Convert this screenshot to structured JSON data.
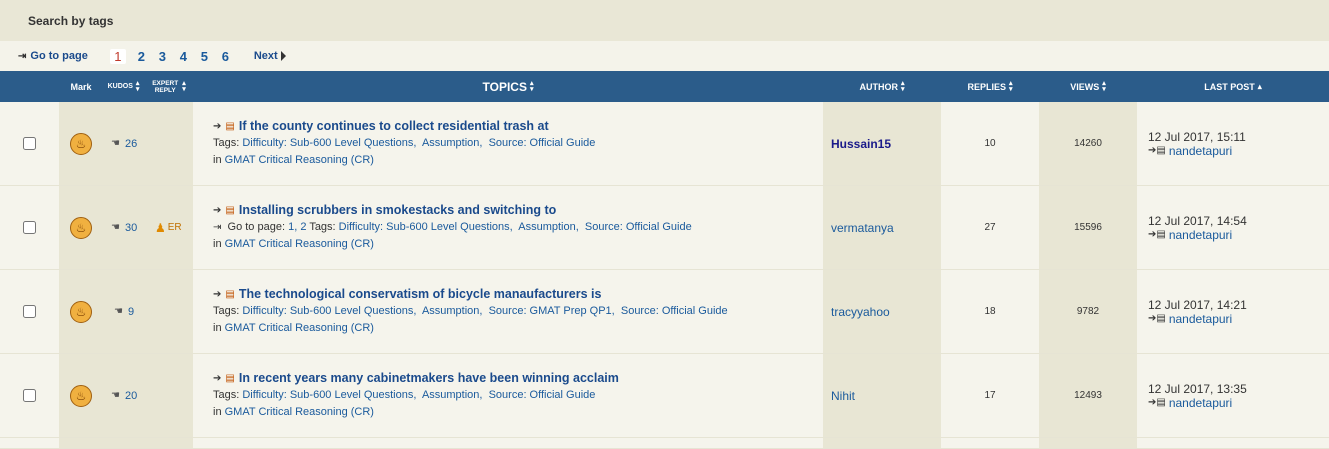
{
  "search": {
    "label": "Search by tags"
  },
  "pager": {
    "goto_label": "Go to page",
    "pages": [
      "1",
      "2",
      "3",
      "4",
      "5",
      "6"
    ],
    "current": "1",
    "next_label": "Next"
  },
  "header": {
    "mark": "Mark",
    "kudos": "KUDOS",
    "expert_reply": "EXPERT REPLY",
    "topics": "TOPICS",
    "author": "AUTHOR",
    "replies": "REPLIES",
    "views": "VIEWS",
    "last_post": "LAST POST"
  },
  "topics": [
    {
      "title": "If the county continues to collect residential trash at",
      "kudos": "26",
      "expert": "",
      "goto_pages": "",
      "tags_label": "Tags:",
      "tags": [
        "Difficulty: Sub-600 Level Questions,",
        "Assumption,",
        "Source: Official Guide"
      ],
      "forum_prefix": "in",
      "forum": "GMAT Critical Reasoning (CR)",
      "author": "Hussain15",
      "author_bold": true,
      "replies": "10",
      "views": "14260",
      "last_date": "12 Jul 2017, 15:11",
      "last_user": "nandetapuri"
    },
    {
      "title": "Installing scrubbers in smokestacks and switching to",
      "kudos": "30",
      "expert": "ER",
      "goto_pages": "Go to page:",
      "goto_links": [
        "1,",
        "2"
      ],
      "tags_label": "Tags:",
      "tags": [
        "Difficulty: Sub-600 Level Questions,",
        "Assumption,",
        "Source: Official Guide"
      ],
      "forum_prefix": "in",
      "forum": "GMAT Critical Reasoning (CR)",
      "author": "vermatanya",
      "author_bold": false,
      "replies": "27",
      "views": "15596",
      "last_date": "12 Jul 2017, 14:54",
      "last_user": "nandetapuri"
    },
    {
      "title": "The technological conservatism of bicycle manaufacturers is",
      "kudos": "9",
      "expert": "",
      "goto_pages": "",
      "tags_label": "Tags:",
      "tags": [
        "Difficulty: Sub-600 Level Questions,",
        "Assumption,",
        "Source: GMAT Prep QP1,",
        "Source: Official Guide"
      ],
      "forum_prefix": "in",
      "forum": "GMAT Critical Reasoning (CR)",
      "author": "tracyyahoo",
      "author_bold": false,
      "replies": "18",
      "views": "9782",
      "last_date": "12 Jul 2017, 14:21",
      "last_user": "nandetapuri"
    },
    {
      "title": "In recent years many cabinetmakers have been winning acclaim",
      "kudos": "20",
      "expert": "",
      "goto_pages": "",
      "tags_label": "Tags:",
      "tags": [
        "Difficulty: Sub-600 Level Questions,",
        "Assumption,",
        "Source: Official Guide"
      ],
      "forum_prefix": "in",
      "forum": "GMAT Critical Reasoning (CR)",
      "author": "Nihit",
      "author_bold": false,
      "replies": "17",
      "views": "12493",
      "last_date": "12 Jul 2017, 13:35",
      "last_user": "nandetapuri"
    }
  ],
  "icons": {
    "goto": "goto-page-icon",
    "next": "next-arrow-icon",
    "sort": "sort-icon",
    "hot": "hot-topic-icon",
    "kudos": "kudos-icon",
    "expert": "expert-icon",
    "new_post": "new-post-icon",
    "last_post": "last-post-icon"
  },
  "colors": {
    "header_bg": "#2b5c8a",
    "link": "#1a5a9c",
    "current_page": "#c0392b",
    "hot": "#f0b040"
  }
}
